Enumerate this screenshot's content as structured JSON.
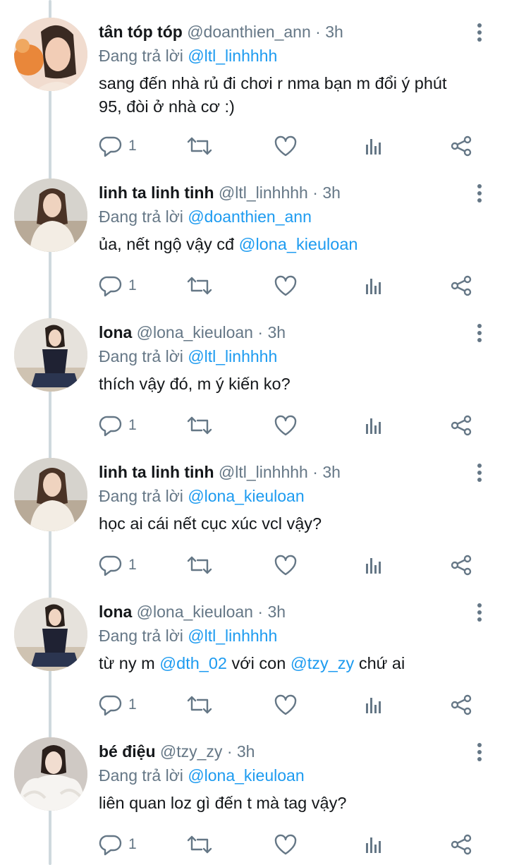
{
  "reply_prefix": "Đang trả lời",
  "separator": "·",
  "tweets": [
    {
      "name": "tân tóp tóp",
      "handle": "@doanthien_ann",
      "time": "3h",
      "reply_to": "@ltl_linhhhh",
      "text_line1": "sang đến nhà rủ đi chơi r nma bạn m đổi ý phút",
      "text_line2": "95, đòi ở nhà cơ :)",
      "reply_count": "1",
      "avatar": "avatar-photo"
    },
    {
      "name": "linh ta linh tinh",
      "handle": "@ltl_linhhhh",
      "time": "3h",
      "reply_to": "@doanthien_ann",
      "text_before": "ủa, nết ngộ vậy cđ ",
      "mention": "@lona_kieuloan",
      "reply_count": "1",
      "avatar": "avatar-photo"
    },
    {
      "name": "lona",
      "handle": "@lona_kieuloan",
      "time": "3h",
      "reply_to": "@ltl_linhhhh",
      "text": "thích vậy đó, m ý kiến ko?",
      "reply_count": "1",
      "avatar": "avatar-photo"
    },
    {
      "name": "linh ta linh tinh",
      "handle": "@ltl_linhhhh",
      "time": "3h",
      "reply_to": "@lona_kieuloan",
      "text": "học ai cái nết cục xúc vcl vậy?",
      "reply_count": "1",
      "avatar": "avatar-photo"
    },
    {
      "name": "lona",
      "handle": "@lona_kieuloan",
      "time": "3h",
      "reply_to": "@ltl_linhhhh",
      "text_a": "từ ny m ",
      "mention_a": "@dth_02",
      "text_b": " với con ",
      "mention_b": "@tzy_zy",
      "text_c": " chứ ai",
      "reply_count": "1",
      "avatar": "avatar-photo"
    },
    {
      "name": "bé điệu",
      "handle": "@tzy_zy",
      "time": "3h",
      "reply_to": "@lona_kieuloan",
      "text": "liên quan loz gì đến t mà tag vậy?",
      "reply_count": "1",
      "avatar": "avatar-photo"
    }
  ],
  "colors": {
    "mention": "#1d9bf0",
    "muted": "#657786",
    "thread_line": "#cfd9de"
  },
  "icons": [
    "reply-icon",
    "retweet-icon",
    "like-icon",
    "analytics-icon",
    "share-icon",
    "more-icon"
  ]
}
